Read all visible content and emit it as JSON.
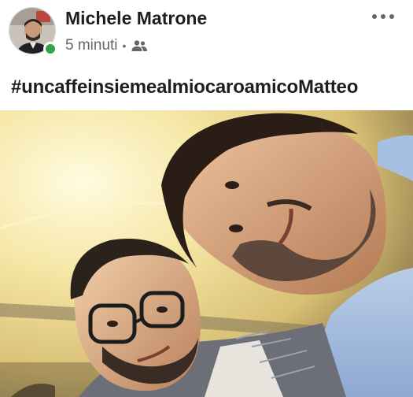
{
  "post": {
    "author_name": "Michele Matrone",
    "timestamp": "5 minuti",
    "separator": "•",
    "audience_icon": "friends-icon",
    "online_status_color": "#31a24c",
    "caption": "#uncaffeinsiemealmiocaroamicoMatteo",
    "more_icon": "more-options-icon"
  },
  "colors": {
    "text_primary": "#1c1e21",
    "text_secondary": "#65676b",
    "background": "#ffffff"
  }
}
